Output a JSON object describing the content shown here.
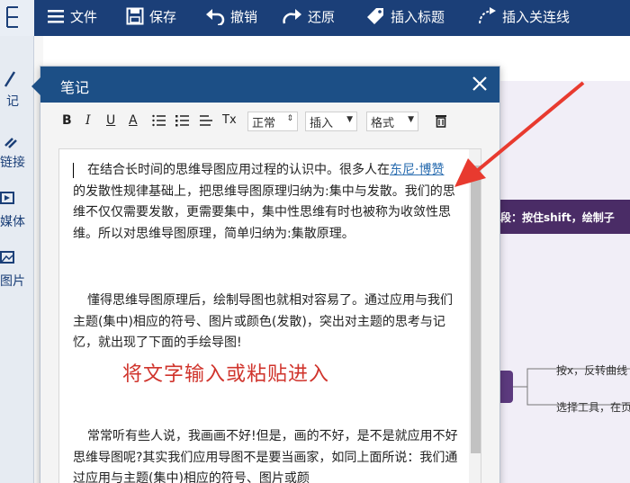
{
  "toolbar": {
    "file": "文件",
    "save": "保存",
    "undo": "撤销",
    "redo": "还原",
    "insert_tag": "插入标题",
    "insert_relation": "插入关连线"
  },
  "sidebar": {
    "note": "记",
    "link": "链接",
    "media": "媒体",
    "image": "图片"
  },
  "canvas": {
    "banner": "段：按住shift，绘制子",
    "node1": "按ⅹ，反转曲线",
    "node2": "选择工具，在页"
  },
  "dialog": {
    "title": "笔记",
    "format_bar": {
      "bold": "B",
      "italic": "I",
      "underline": "U",
      "font_color": "A",
      "clear_format": "Tx",
      "style_select": "正常",
      "insert_select": "插入",
      "format_select": "格式"
    },
    "editor": {
      "para1_before_link": "在结合长时间的思维导图应用过程的认识中。很多人在",
      "para1_link": "东尼·博赞",
      "para1_after_link": "的发散性规律基础上，把思维导图原理归纳为:集中与发散。我们的思维不仅仅需要发散，更需要集中，集中性思维有时也被称为收敛性思维。所以对思维导图原理，简单归纳为:集散原理。",
      "para2": "懂得思维导图原理后，绘制导图也就相对容易了。通过应用与我们主题(集中)相应的符号、图片或颜色(发散)，突出对主题的思考与记忆，就出现了下面的手绘导图!",
      "annotation": "将文字输入或粘贴进入",
      "para3": "常常听有些人说，我画画不好!但是，画的不好，是不是就应用不好思维导图呢?其实我们应用导图不是要当画家，如同上面所说：我们通过应用与主题(集中)相应的符号、图片或颜"
    }
  },
  "colors": {
    "toolbar_bg": "#1b3f78",
    "dialog_header": "#1c4f86",
    "annotation_red": "#d0342c",
    "arrow_red": "#e83a2f"
  }
}
